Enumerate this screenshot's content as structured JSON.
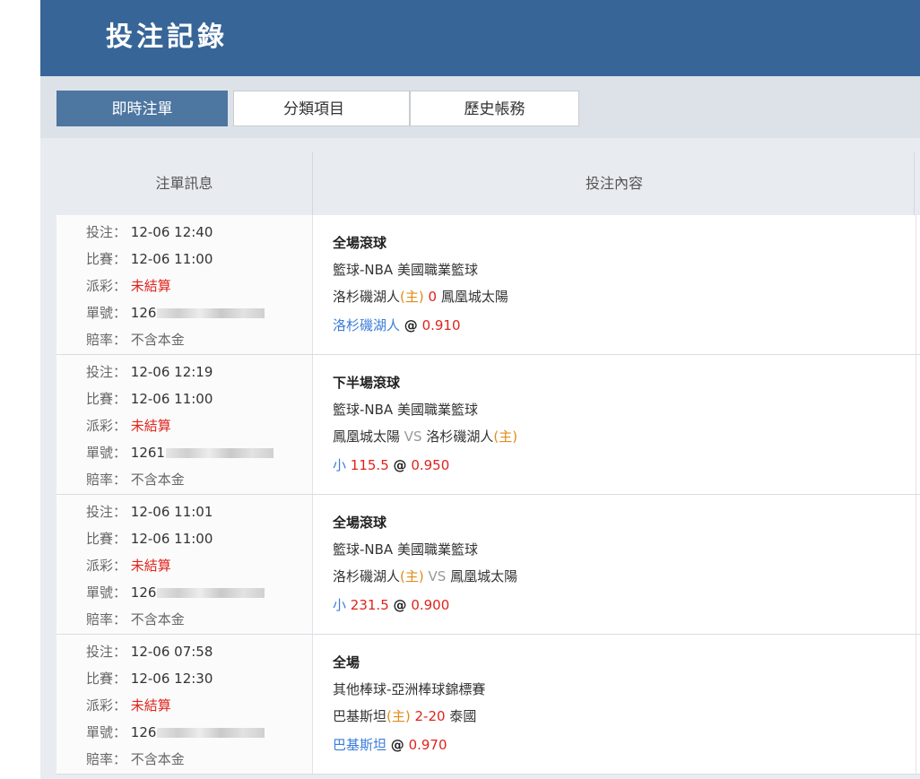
{
  "header": {
    "title": "投注記錄"
  },
  "tabs": [
    {
      "label": "即時注單",
      "active": true
    },
    {
      "label": "分類項目",
      "active": false
    },
    {
      "label": "歷史帳務",
      "active": false
    }
  ],
  "table": {
    "columns": [
      "注單訊息",
      "投注內容"
    ],
    "labels": {
      "bet_time": "投注：",
      "match_time": "比賽：",
      "payout": "派彩：",
      "ticket": "單號：",
      "odds": "賠率："
    },
    "rows": [
      {
        "bet_time": "12-06 12:40",
        "match_time": "12-06 11:00",
        "payout": "未結算",
        "ticket_prefix": "126",
        "odds_type": "不含本金",
        "bet_type": "全場滾球",
        "league": "籃球-NBA 美國職業籃球",
        "home": "洛杉磯湖人",
        "home_tag": "(主)",
        "mid": "0",
        "away": "鳳凰城太陽",
        "pick": "洛杉磯湖人",
        "pick_value": "",
        "at": "@",
        "price": "0.910"
      },
      {
        "bet_time": "12-06 12:19",
        "match_time": "12-06 11:00",
        "payout": "未結算",
        "ticket_prefix": "1261",
        "odds_type": "不含本金",
        "bet_type": "下半場滾球",
        "league": "籃球-NBA 美國職業籃球",
        "team1": "鳳凰城太陽",
        "vs": "VS",
        "team2": "洛杉磯湖人",
        "team2_tag": "(主)",
        "pick": "小",
        "pick_value": "115.5",
        "at": "@",
        "price": "0.950"
      },
      {
        "bet_time": "12-06 11:01",
        "match_time": "12-06 11:00",
        "payout": "未結算",
        "ticket_prefix": "126",
        "odds_type": "不含本金",
        "bet_type": "全場滾球",
        "league": "籃球-NBA 美國職業籃球",
        "team1": "洛杉磯湖人",
        "team1_tag": "(主)",
        "vs": "VS",
        "team2": "鳳凰城太陽",
        "pick": "小",
        "pick_value": "231.5",
        "at": "@",
        "price": "0.900"
      },
      {
        "bet_time": "12-06 07:58",
        "match_time": "12-06 12:30",
        "payout": "未結算",
        "ticket_prefix": "126",
        "odds_type": "不含本金",
        "bet_type": "全場",
        "league": "其他棒球-亞洲棒球錦標賽",
        "home": "巴基斯坦",
        "home_tag": "(主)",
        "mid": "2-20",
        "away": "泰國",
        "pick": "巴基斯坦",
        "pick_value": "",
        "at": "@",
        "price": "0.970"
      }
    ]
  }
}
